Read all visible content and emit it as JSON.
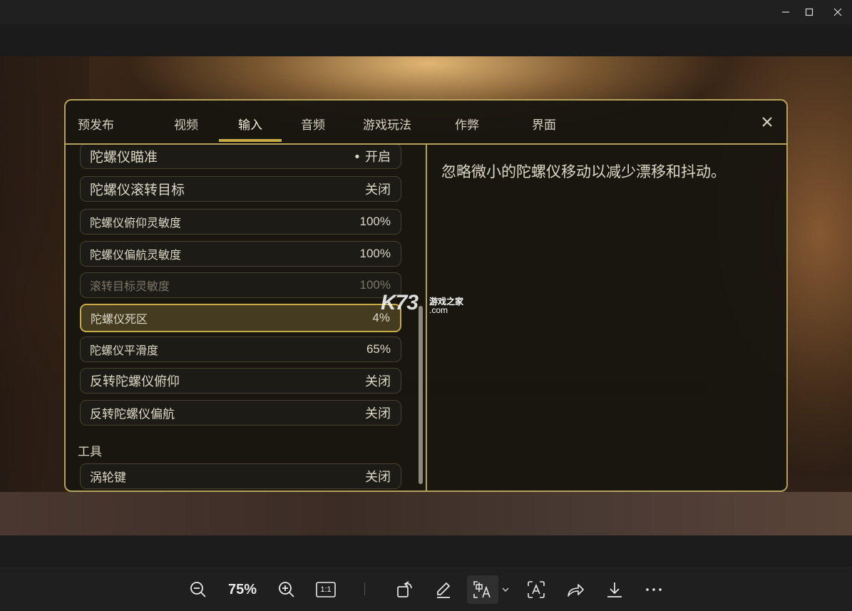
{
  "window": {
    "controls": [
      "minimize-icon",
      "maximize-icon",
      "close-icon"
    ]
  },
  "settings": {
    "tabs": [
      {
        "label": "预发布"
      },
      {
        "label": "视频"
      },
      {
        "label": "输入",
        "active": true
      },
      {
        "label": "音频"
      },
      {
        "label": "游戏玩法"
      },
      {
        "label": "作弊"
      },
      {
        "label": "界面"
      }
    ],
    "rows": [
      {
        "label": "陀螺仪瞄准",
        "value": "• 开启"
      },
      {
        "label": "陀螺仪滚转目标",
        "value": "关闭"
      },
      {
        "label": "陀螺仪俯仰灵敏度",
        "value": "100%"
      },
      {
        "label": "陀螺仪偏航灵敏度",
        "value": "100%"
      },
      {
        "label": "滚转目标灵敏度",
        "value": "100%",
        "disabled": true
      },
      {
        "label": "陀螺仪死区",
        "value": "4%",
        "selected": true
      },
      {
        "label": "陀螺仪平滑度",
        "value": "65%"
      },
      {
        "label": "反转陀螺仪俯仰",
        "value": "关闭"
      },
      {
        "label": "反转陀螺仪偏航",
        "value": "关闭"
      }
    ],
    "section_tools": "工具",
    "tools_rows": [
      {
        "label": "涡轮键",
        "value": "关闭"
      }
    ],
    "description": "忽略微小的陀螺仪移动以减少漂移和抖动。"
  },
  "watermark": {
    "brand": "K73",
    "text": "游戏之家",
    "domain": ".com"
  },
  "viewer_toolbar": {
    "zoom_level": "75%",
    "actual_size_label": "1:1",
    "icons": [
      "zoom-out-icon",
      "zoom-in-icon",
      "actual-size-icon",
      "rotate-icon",
      "edit-icon",
      "text-recognize-icon",
      "chevron-down-icon",
      "visual-search-icon",
      "share-icon",
      "download-icon",
      "more-icon"
    ]
  }
}
